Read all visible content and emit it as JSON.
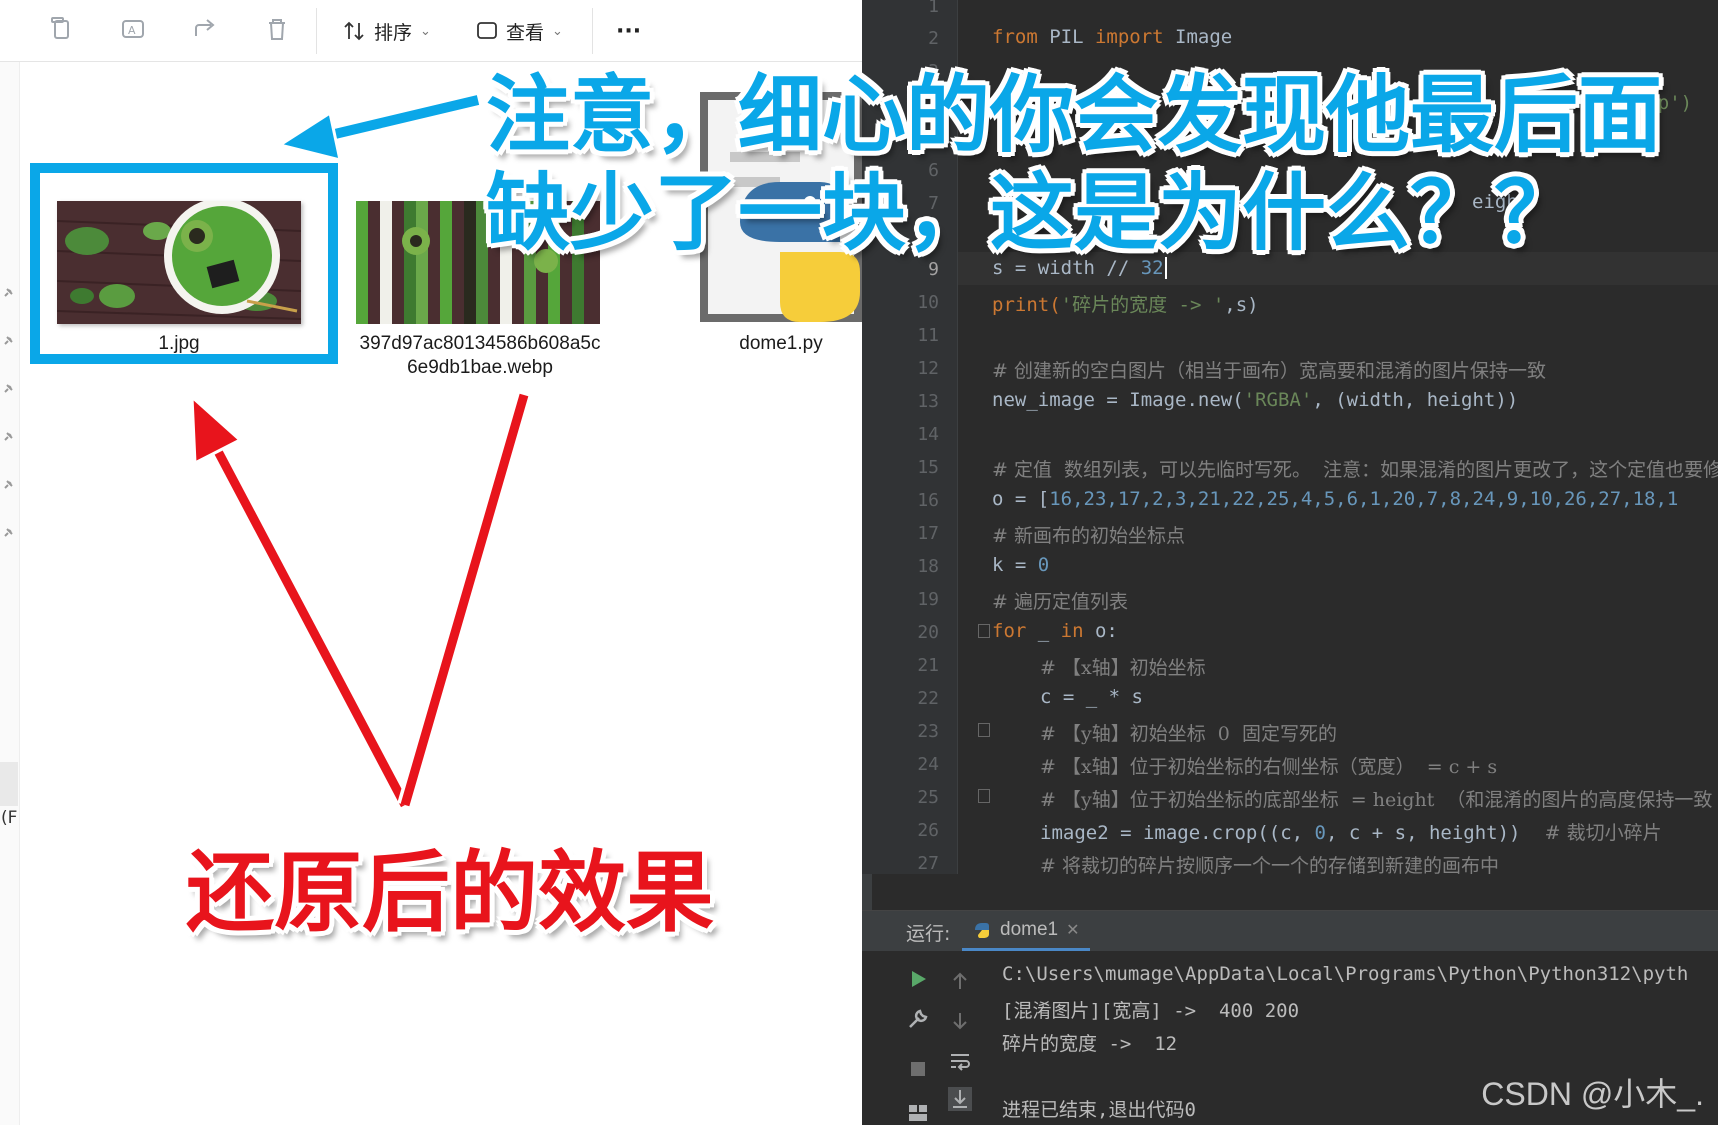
{
  "toolbar": {
    "sort_label": "排序",
    "view_label": "查看",
    "more_label": "···"
  },
  "files": [
    {
      "name": "1.jpg"
    },
    {
      "name_line1": "397d97ac80134586b608a5c",
      "name_line2": "6e9db1bae.webp"
    },
    {
      "name": "dome1.py"
    }
  ],
  "left_pane": {
    "partial_text": "(F"
  },
  "editor": {
    "lines": [
      {
        "n": "1"
      },
      {
        "n": "2"
      },
      {
        "n": "3"
      },
      {
        "n": "4"
      },
      {
        "n": "5"
      },
      {
        "n": "6"
      },
      {
        "n": "7"
      },
      {
        "n": "8"
      },
      {
        "n": "9"
      },
      {
        "n": "10"
      },
      {
        "n": "11"
      },
      {
        "n": "12"
      },
      {
        "n": "13"
      },
      {
        "n": "14"
      },
      {
        "n": "15"
      },
      {
        "n": "16"
      },
      {
        "n": "17"
      },
      {
        "n": "18"
      },
      {
        "n": "19"
      },
      {
        "n": "20"
      },
      {
        "n": "21"
      },
      {
        "n": "22"
      },
      {
        "n": "23"
      },
      {
        "n": "24"
      },
      {
        "n": "25"
      },
      {
        "n": "26"
      },
      {
        "n": "27"
      }
    ],
    "code": {
      "l2": [
        "from",
        " PIL ",
        "import",
        " Image"
      ],
      "l4_tail": ".webp')",
      "l7_tail": "eight",
      "l9": [
        "s = width // ",
        "32"
      ],
      "l10": [
        "print(",
        "'碎片的宽度 -> '",
        ",s)"
      ],
      "l12": "# 创建新的空白图片（相当于画布）宽高要和混淆的图片保持一致",
      "l13": [
        "new_image = Image.new(",
        "'RGBA'",
        ", (width, height))"
      ],
      "l15": "# 定值  数组列表，可以先临时写死。  注意：如果混淆的图片更改了，这个定值也要修",
      "l16_prefix": "o = [",
      "l16_nums": "16,23,17,2,3,21,22,25,4,5,6,1,20,7,8,24,9,10,26,27,18,1",
      "l17": "# 新画布的初始坐标点",
      "l18": [
        "k = ",
        "0"
      ],
      "l19": "# 遍历定值列表",
      "l20": [
        "for",
        " _ ",
        "in",
        " o:"
      ],
      "l21": "# 【x轴】初始坐标",
      "l22": "c = _ * s",
      "l23": "# 【y轴】初始坐标  0  固定写死的",
      "l24": "# 【x轴】位于初始坐标的右侧坐标（宽度）  = c + s",
      "l25": "# 【y轴】位于初始坐标的底部坐标  = height  （和混淆的图片的高度保持一致",
      "l26": [
        "image2 = image.crop((c, ",
        "0",
        ", c + s, height))",
        "    # 裁切小碎片"
      ],
      "l27": "# 将裁切的碎片按顺序一个一个的存储到新建的画布中"
    }
  },
  "run_panel": {
    "title": "运行:",
    "tab_label": "dome1",
    "output": [
      "C:\\Users\\mumage\\AppData\\Local\\Programs\\Python\\Python312\\pyth",
      "[混淆图片][宽高] ->  400 200",
      "碎片的宽度 ->  12",
      "",
      "进程已结束,退出代码0"
    ]
  },
  "watermark": "CSDN @小木_.",
  "annotations": {
    "blue_line1": "注意，细心的你会发现他最后面",
    "blue_line2": "缺少了一块，这是为什么？？",
    "red_caption": "还原后的效果"
  },
  "colors": {
    "annotation_blue": "#0aa7e8",
    "annotation_red": "#e8141c",
    "editor_bg": "#2b2b2b",
    "keyword": "#cc7832",
    "string": "#6a8759",
    "number": "#6897bb"
  }
}
